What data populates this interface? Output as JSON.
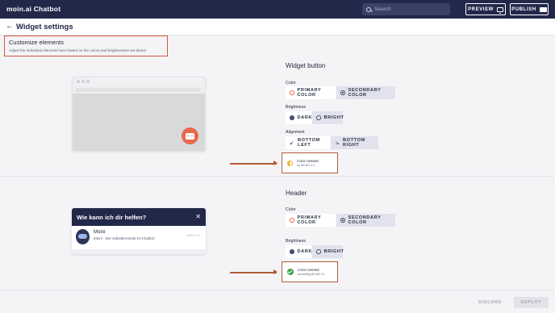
{
  "app": {
    "title": "moin.ai Chatbot"
  },
  "topbar": {
    "search_placeholder": "Search",
    "preview_label": "PREVIEW",
    "publish_label": "PUBLISH"
  },
  "page": {
    "title": "Widget settings"
  },
  "intro": {
    "title": "Customize elements",
    "description": "Adjust the individual elements here based on the colors and brightnesses set above."
  },
  "widget_button": {
    "title": "Widget button",
    "color_label": "Color",
    "color_options": [
      "PRIMARY COLOR",
      "SECONDARY COLOR"
    ],
    "color_selected": "SECONDARY COLOR",
    "brightness_label": "Brightness",
    "brightness_options": [
      "DARK",
      "BRIGHT"
    ],
    "brightness_selected": "BRIGHT",
    "alignment_label": "Alignment",
    "alignment_options": [
      "BOTTOM LEFT",
      "BOTTOM RIGHT"
    ],
    "alignment_selected": "BOTTOM RIGHT",
    "contrast_title": "Color contrast",
    "contrast_sub": "no WCAG 2.1"
  },
  "header": {
    "title": "Header",
    "color_label": "Color",
    "color_options": [
      "PRIMARY COLOR",
      "SECONDARY COLOR"
    ],
    "color_selected": "SECONDARY COLOR",
    "brightness_label": "Brightness",
    "brightness_options": [
      "DARK",
      "BRIGHT"
    ],
    "brightness_selected": "BRIGHT",
    "contrast_title": "Color contrast",
    "contrast_sub": "according WCAG 2.1"
  },
  "chat_preview": {
    "heading": "Wie kann ich dir helfen?",
    "close": "✕",
    "bot_name": "Moini",
    "bot_subtitle": "Moini - Der selbstlernende KI-Chatbot",
    "logo_text": "moin.ai"
  },
  "footer": {
    "discard_label": "DISCARD",
    "deploy_label": "DEPLOY"
  },
  "colors": {
    "navy": "#22284a",
    "accent": "#e9694d",
    "highlight": "#d9553a",
    "ok": "#3ea44a",
    "warn": "#e2b52e"
  }
}
